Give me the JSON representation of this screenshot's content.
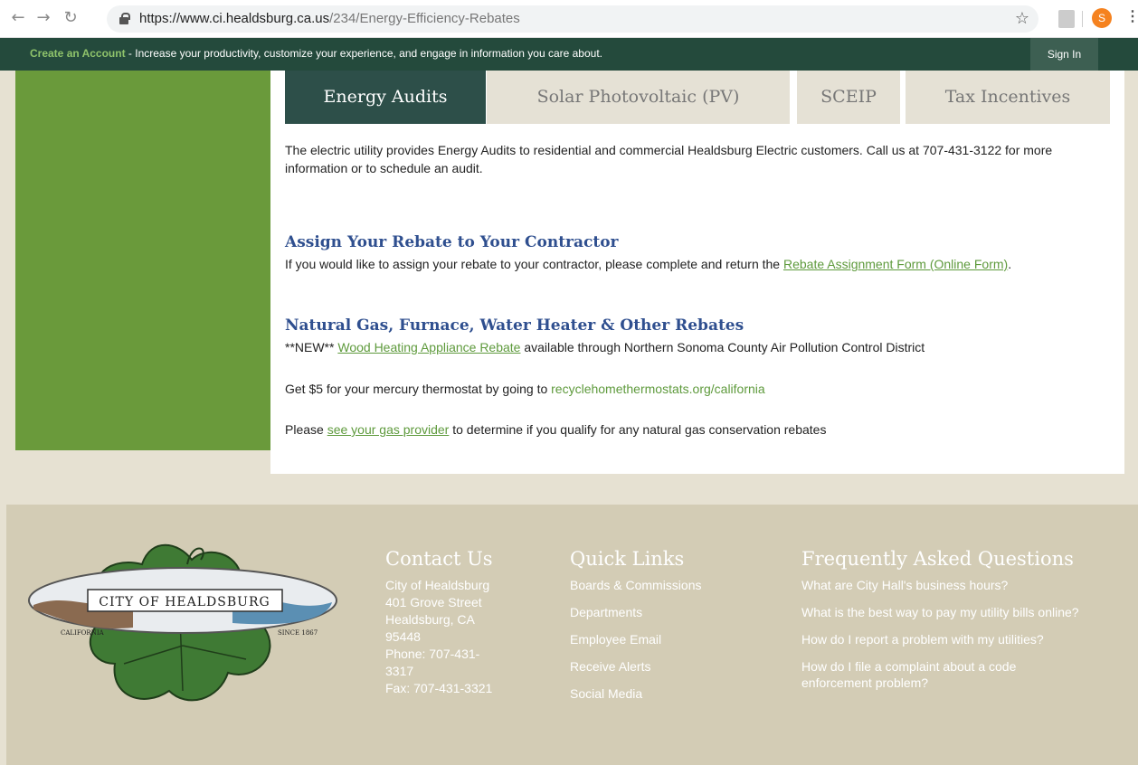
{
  "browser": {
    "url_host": "https://www.ci.healdsburg.ca.us",
    "url_path": "/234/Energy-Efficiency-Rebates",
    "avatar_letter": "S"
  },
  "account_bar": {
    "create_link": "Create an Account",
    "message": " - Increase your productivity, customize your experience, and engage in information you care about.",
    "sign_in": "Sign In"
  },
  "tabs": [
    {
      "label": "Energy Audits",
      "active": true
    },
    {
      "label": "Solar Photovoltaic (PV)",
      "active": false
    },
    {
      "label": "SCEIP",
      "active": false
    },
    {
      "label": "Tax Incentives",
      "active": false
    }
  ],
  "content": {
    "intro": "The electric utility provides Energy Audits to residential and commercial Healdsburg Electric customers. Call us at 707-431-3122 for more information or to schedule an audit.",
    "assign": {
      "heading": "Assign Your Rebate to Your Contractor",
      "text_before": "If you would like to assign your rebate to your contractor, please complete and return the ",
      "link": "Rebate Assignment Form (Online Form)",
      "text_after": "."
    },
    "gas": {
      "heading": "Natural Gas, Furnace, Water Heater & Other Rebates",
      "new_prefix": "**NEW** ",
      "new_link": "Wood Heating Appliance Rebate",
      "new_suffix": " available through Northern Sonoma County Air Pollution Control District",
      "thermo_text": "Get $5 for your mercury thermostat by going to ",
      "thermo_link": "recyclehomethermostats.org/california",
      "provider_before": "Please ",
      "provider_link": "see your gas provider",
      "provider_after": " to determine if you qualify for any natural gas conservation rebates"
    }
  },
  "footer": {
    "logo": {
      "name": "CITY OF HEALDSBURG",
      "left": "CALIFORNIA",
      "right": "SINCE 1867"
    },
    "contact": {
      "heading": "Contact Us",
      "lines": [
        "City of Healdsburg",
        "401 Grove Street",
        "Healdsburg, CA",
        "95448",
        "Phone: 707-431-",
        "3317",
        "Fax: 707-431-3321"
      ]
    },
    "quick_links": {
      "heading": "Quick Links",
      "items": [
        "Boards & Commissions",
        "Departments",
        "Employee Email",
        "Receive Alerts",
        "Social Media"
      ]
    },
    "faq": {
      "heading": "Frequently Asked Questions",
      "items": [
        "What are City Hall's business hours?",
        "What is the best way to pay my utility bills online?",
        "How do I report a problem with my utilities?",
        "How do I file a complaint about a code enforcement problem?"
      ]
    }
  },
  "colors": {
    "account_bar": "#244a3c",
    "sidebar": "#6a9a3b",
    "active_tab": "#2d4f49",
    "heading_blue": "#2f4f8f",
    "link_green": "#5e9a3c",
    "footer": "#d3ccb5"
  }
}
